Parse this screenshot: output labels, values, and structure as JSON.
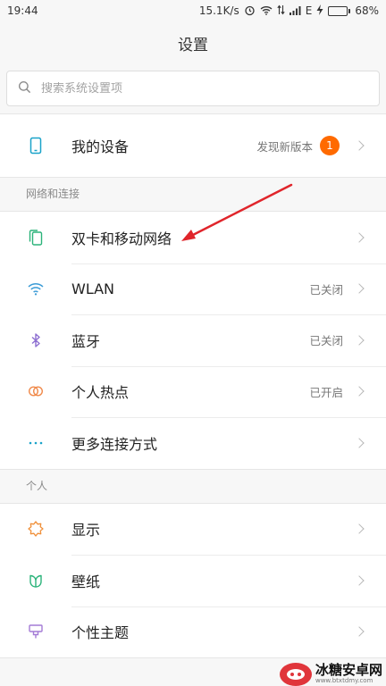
{
  "status_bar": {
    "time": "19:44",
    "speed": "15.1K/s",
    "network_letter": "E",
    "battery": "68%",
    "battery_level": 0.68
  },
  "header": {
    "title": "设置"
  },
  "search": {
    "placeholder": "搜索系统设置项",
    "icon": "search-icon"
  },
  "device": {
    "label": "我的设备",
    "value": "发现新版本",
    "badge": "1",
    "icon": "phone-icon"
  },
  "sections": {
    "network": {
      "title": "网络和连接",
      "items": [
        {
          "label": "双卡和移动网络",
          "value": "",
          "icon": "sim-card-icon"
        },
        {
          "label": "WLAN",
          "value": "已关闭",
          "icon": "wifi-icon"
        },
        {
          "label": "蓝牙",
          "value": "已关闭",
          "icon": "bluetooth-icon"
        },
        {
          "label": "个人热点",
          "value": "已开启",
          "icon": "hotspot-icon"
        },
        {
          "label": "更多连接方式",
          "value": "",
          "icon": "more-dots-icon"
        }
      ]
    },
    "personal": {
      "title": "个人",
      "items": [
        {
          "label": "显示",
          "value": "",
          "icon": "display-sun-icon"
        },
        {
          "label": "壁纸",
          "value": "",
          "icon": "wallpaper-icon"
        },
        {
          "label": "个性主题",
          "value": "",
          "icon": "theme-brush-icon"
        }
      ]
    }
  },
  "watermark": {
    "title": "冰糖安卓网",
    "url": "www.btxtdmy.com"
  },
  "colors": {
    "accent": "#ff6a00",
    "arrow": "#e0252b",
    "background": "#f7f7f7"
  }
}
